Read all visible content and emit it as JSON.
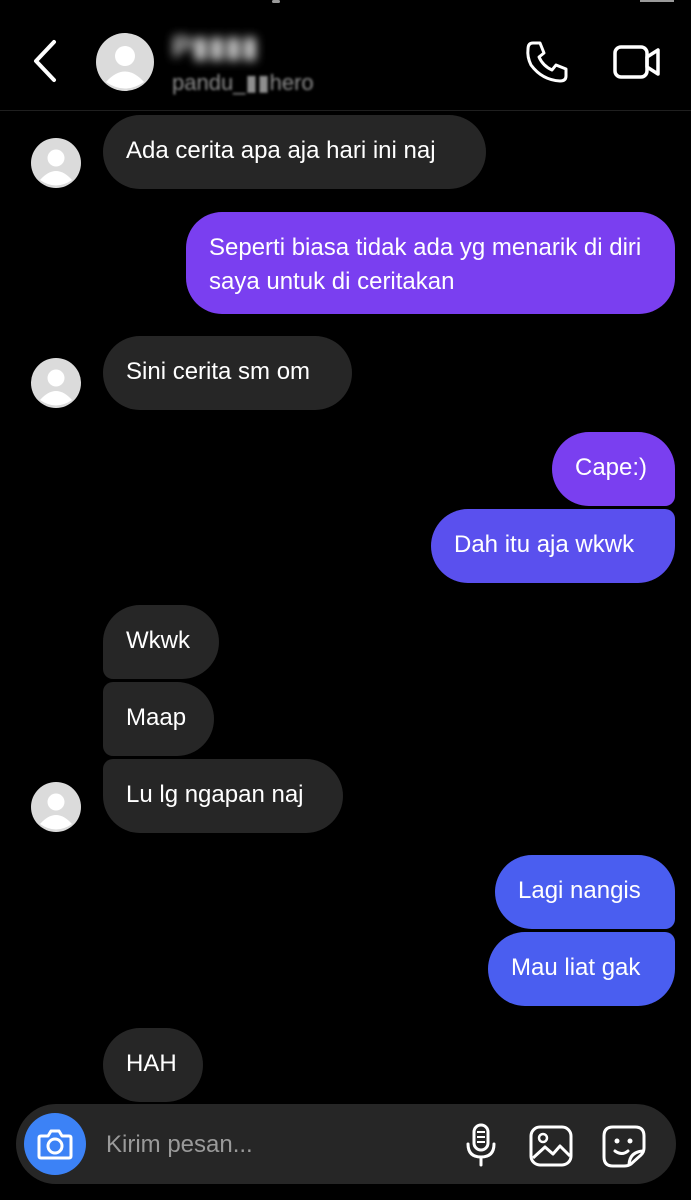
{
  "header": {
    "contact_name": "P▮▮▮▮",
    "contact_handle": "pandu_▮▮hero",
    "back_icon": "chevron-left-icon",
    "call_icon": "phone-icon",
    "video_icon": "video-camera-icon"
  },
  "messages": [
    {
      "from": "contact",
      "text": "Ada cerita apa aja hari ini naj"
    },
    {
      "from": "me",
      "text": "Seperti biasa tidak ada yg menarik di diri saya untuk di ceritakan"
    },
    {
      "from": "contact",
      "text": "Sini cerita sm om"
    },
    {
      "from": "me",
      "text": "Cape:)"
    },
    {
      "from": "me",
      "text": "Dah itu aja wkwk"
    },
    {
      "from": "contact",
      "text": "Wkwk"
    },
    {
      "from": "contact",
      "text": "Maap"
    },
    {
      "from": "contact",
      "text": "Lu lg ngapan naj"
    },
    {
      "from": "me",
      "text": "Lagi nangis"
    },
    {
      "from": "me",
      "text": "Mau liat gak"
    },
    {
      "from": "contact",
      "text": "HAH"
    }
  ],
  "composer": {
    "placeholder": "Kirim pesan...",
    "camera_icon": "camera-icon",
    "mic_icon": "microphone-icon",
    "gallery_icon": "image-icon",
    "sticker_icon": "sticker-icon"
  },
  "colors": {
    "background": "#000000",
    "incoming_bubble": "#262626",
    "outgoing_purple": "#7a3ff0",
    "outgoing_indigo": "#5a50ee",
    "outgoing_blue": "#4a5ef0",
    "camera_button": "#3c82f6"
  }
}
